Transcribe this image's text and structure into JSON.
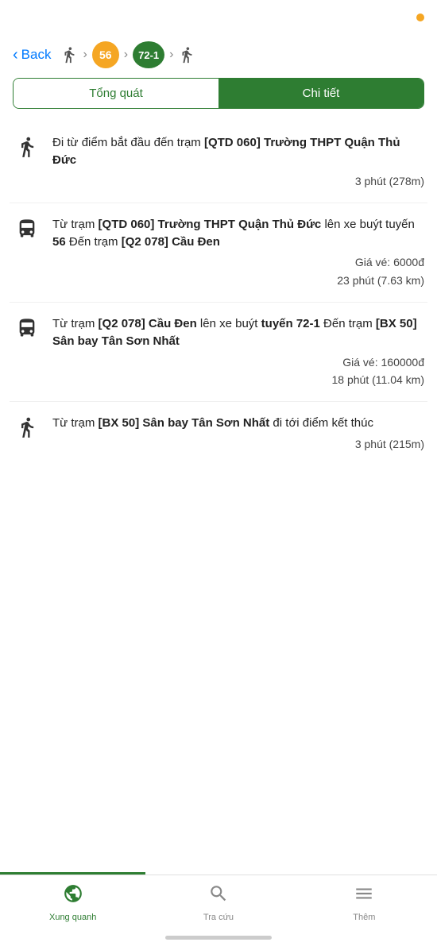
{
  "statusBar": {
    "indicator": "dot"
  },
  "header": {
    "back_label": "Back",
    "route_56": "56",
    "route_721": "72-1"
  },
  "tabs": {
    "inactive_label": "Tổng quát",
    "active_label": "Chi tiết"
  },
  "steps": [
    {
      "type": "walk",
      "text_plain": "Đi từ điểm bắt đầu đến trạm ",
      "text_bold": "[QTD 060] Trường THPT Quận Thủ Đức",
      "meta": "3 phút (278m)"
    },
    {
      "type": "bus",
      "text_plain": "Từ trạm ",
      "text_bold_1": "[QTD 060] Trường THPT Quận Thủ Đức",
      "text_mid": " lên xe buýt tuyến ",
      "text_bold_2": "56",
      "text_mid2": " Đến trạm ",
      "text_bold_3": "[Q2 078] Cầu Đen",
      "meta_price": "Giá vé: 6000đ",
      "meta_time": "23 phút (7.63 km)"
    },
    {
      "type": "bus",
      "text_plain": "Từ trạm ",
      "text_bold_1": "[Q2 078] Cầu Đen",
      "text_mid": " lên xe buýt tuyến ",
      "text_bold_2": "tuyến 72-1",
      "text_mid2": " Đến trạm ",
      "text_bold_3": "[BX 50] Sân bay Tân Sơn Nhất",
      "meta_price": "Giá vé: 160000đ",
      "meta_time": "18 phút (11.04 km)"
    },
    {
      "type": "walk",
      "text_plain": "Từ trạm ",
      "text_bold": "[BX 50] Sân bay Tân Sơn Nhất",
      "text_end": " đi tới điểm kết thúc",
      "meta": "3 phút (215m)"
    }
  ],
  "bottomNav": {
    "items": [
      {
        "label": "Xung quanh",
        "icon": "globe",
        "active": true
      },
      {
        "label": "Tra cứu",
        "icon": "search",
        "active": false
      },
      {
        "label": "Thêm",
        "icon": "menu",
        "active": false
      }
    ]
  }
}
